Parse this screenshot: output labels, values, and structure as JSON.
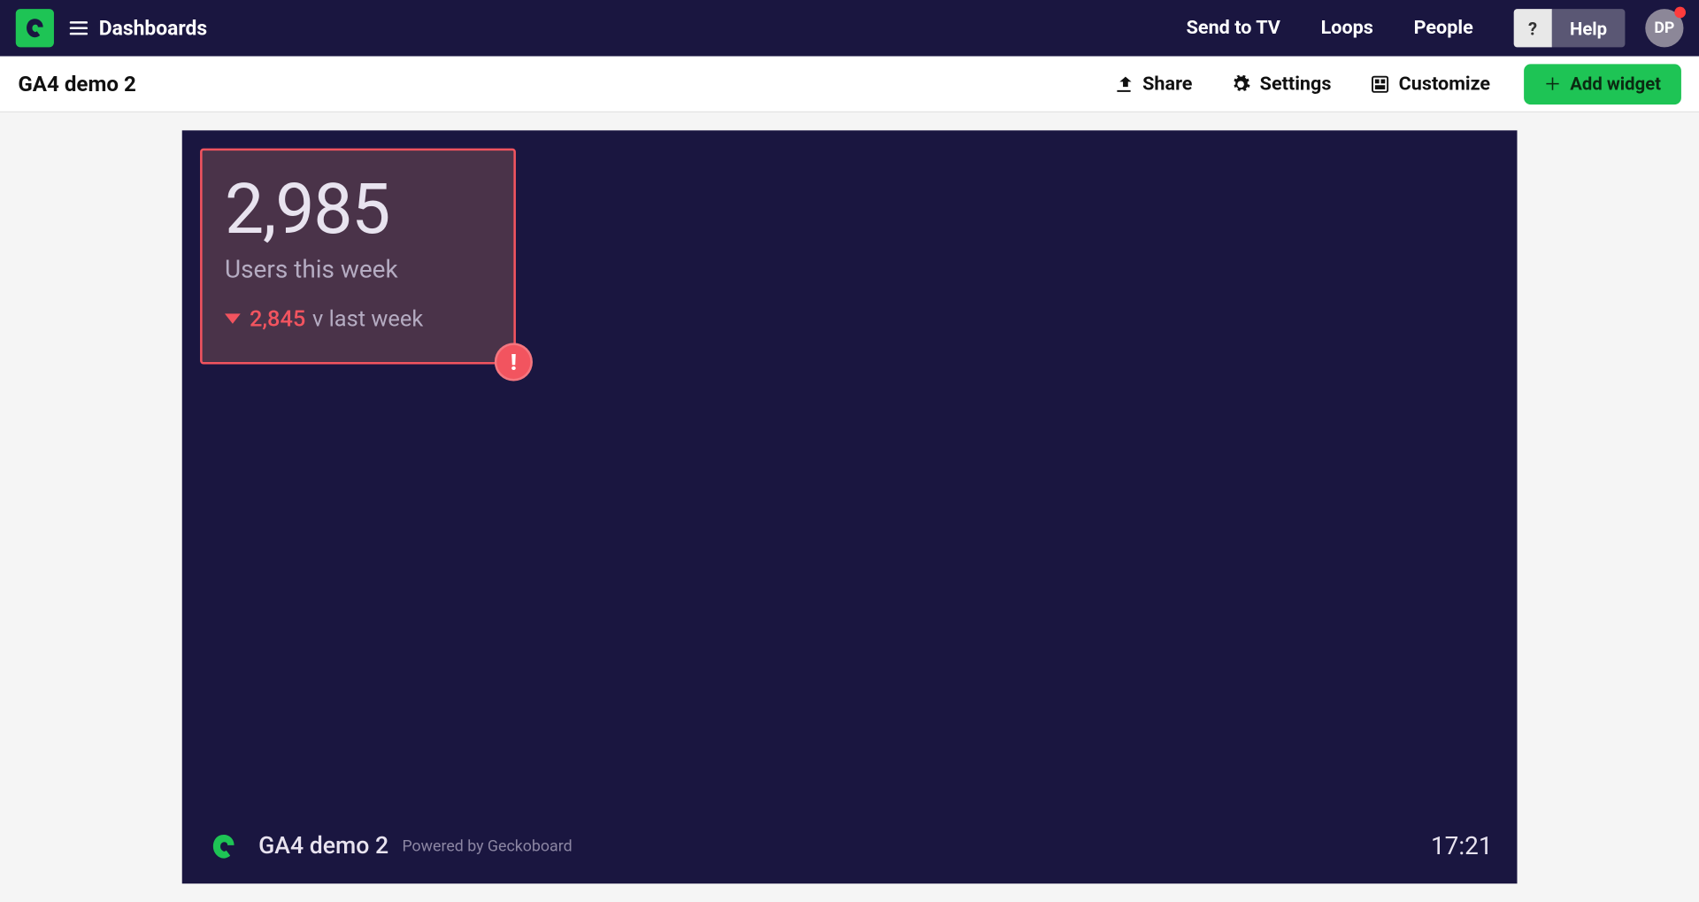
{
  "topnav": {
    "title": "Dashboards",
    "links": {
      "send_tv": "Send to TV",
      "loops": "Loops",
      "people": "People"
    },
    "help_qs": "?",
    "help": "Help",
    "avatar_initials": "DP"
  },
  "subbar": {
    "dash_title": "GA4 demo 2",
    "share": "Share",
    "settings": "Settings",
    "customize": "Customize",
    "add_widget": "Add widget"
  },
  "widget": {
    "value": "2,985",
    "label": "Users this week",
    "compare_value": "2,845",
    "compare_suffix": "v last week",
    "alert_glyph": "!"
  },
  "footer": {
    "title": "GA4 demo 2",
    "powered": "Powered by Geckoboard",
    "time": "17:21"
  }
}
